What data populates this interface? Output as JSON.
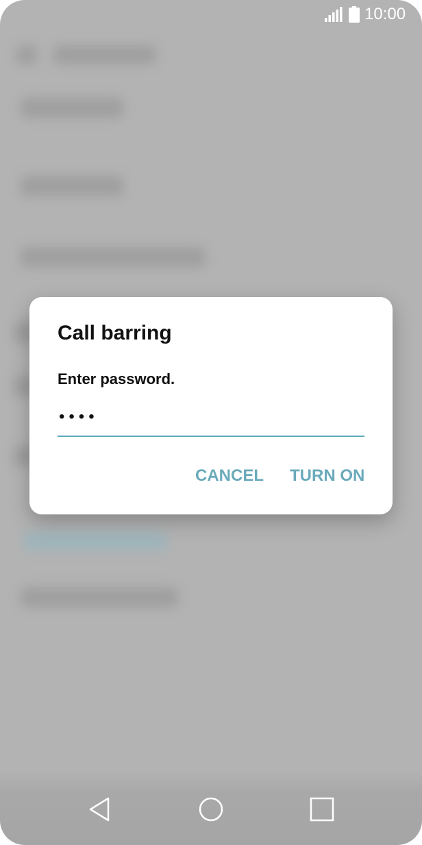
{
  "status_bar": {
    "time": "10:00",
    "icons": [
      "signal-icon",
      "battery-icon"
    ]
  },
  "dialog": {
    "title": "Call barring",
    "message": "Enter password.",
    "password_value": "••••",
    "cancel_label": "CANCEL",
    "confirm_label": "TURN ON",
    "accent_color": "#6aaabb"
  },
  "nav_bar": {
    "icons": [
      "back-icon",
      "home-icon",
      "recent-apps-icon"
    ]
  }
}
